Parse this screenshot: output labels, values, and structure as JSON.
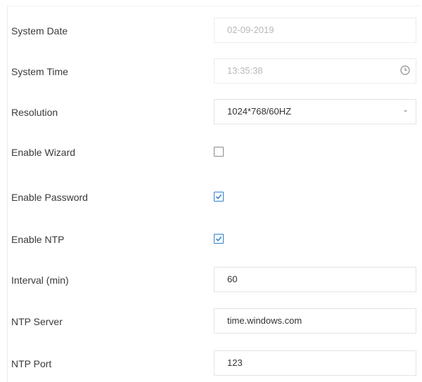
{
  "settings": {
    "system_date": {
      "label": "System Date",
      "value": "02-09-2019"
    },
    "system_time": {
      "label": "System Time",
      "value": "13:35:38",
      "icon": "clock-icon"
    },
    "resolution": {
      "label": "Resolution",
      "value": "1024*768/60HZ",
      "icon": "chevron-down-icon"
    },
    "enable_wizard": {
      "label": "Enable Wizard",
      "checked": false
    },
    "enable_password": {
      "label": "Enable Password",
      "checked": true
    },
    "enable_ntp": {
      "label": "Enable NTP",
      "checked": true
    },
    "interval": {
      "label": "Interval (min)",
      "value": "60"
    },
    "ntp_server": {
      "label": "NTP Server",
      "value": "time.windows.com"
    },
    "ntp_port": {
      "label": "NTP Port",
      "value": "123"
    }
  },
  "colors": {
    "check_accent": "#2f7fd0",
    "border": "#e4e4e4",
    "disabled_text": "#b8b8b8"
  }
}
